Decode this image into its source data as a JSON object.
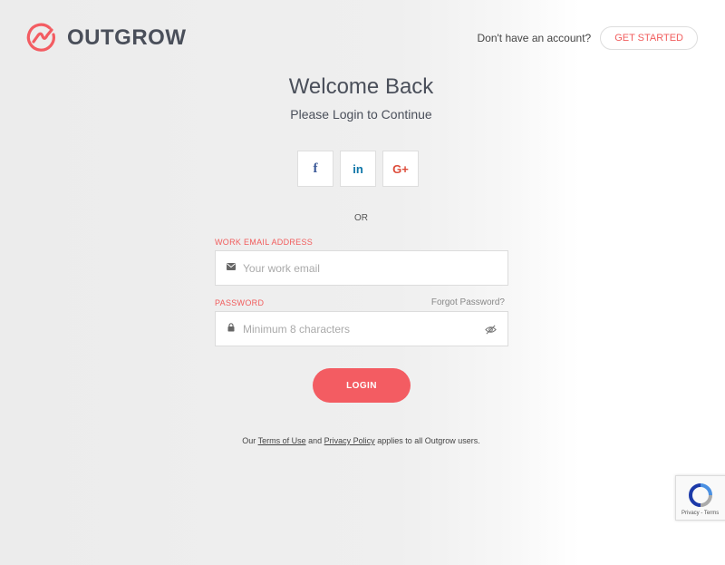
{
  "header": {
    "logo_text": "OUTGROW",
    "no_account_text": "Don't have an account?",
    "get_started_label": "GET STARTED"
  },
  "main": {
    "title": "Welcome Back",
    "subtitle": "Please Login to Continue",
    "social": {
      "facebook": "f",
      "linkedin": "in",
      "google": "G+"
    },
    "or_text": "OR",
    "email": {
      "label": "WORK EMAIL ADDRESS",
      "placeholder": "Your work email",
      "value": ""
    },
    "password": {
      "label": "PASSWORD",
      "placeholder": "Minimum 8 characters",
      "value": "",
      "forgot_label": "Forgot Password?"
    },
    "login_label": "LOGIN",
    "terms": {
      "prefix": "Our",
      "terms_link": "Terms of Use",
      "and": "and",
      "privacy_link": "Privacy Policy",
      "suffix": "applies to all Outgrow users."
    }
  },
  "recaptcha": {
    "text": "Privacy - Terms"
  },
  "colors": {
    "accent": "#f35c62",
    "logo": "#4a4f5a"
  }
}
